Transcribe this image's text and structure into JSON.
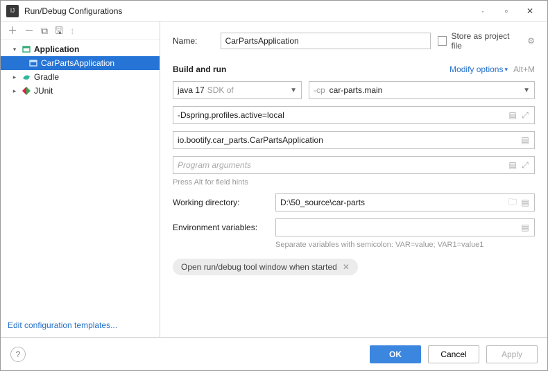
{
  "window": {
    "title": "Run/Debug Configurations"
  },
  "tree": {
    "root": "Application",
    "selected": "CarPartsApplication",
    "gradle": "Gradle",
    "junit": "JUnit"
  },
  "left_footer_link": "Edit configuration templates...",
  "form": {
    "name_label": "Name:",
    "name_value": "CarPartsApplication",
    "store_label": "Store as project file",
    "section": "Build and run",
    "modify": "Modify options",
    "modify_shortcut": "Alt+M",
    "jdk_text": "java 17",
    "jdk_suffix": "SDK of",
    "cp_prefix": "-cp",
    "cp_value": "car-parts.main",
    "vm_options": "-Dspring.profiles.active=local",
    "main_class": "io.bootify.car_parts.CarPartsApplication",
    "program_args_placeholder": "Program arguments",
    "hint": "Press Alt for field hints",
    "wd_label": "Working directory:",
    "wd_value": "D:\\50_source\\car-parts",
    "env_label": "Environment variables:",
    "env_hint": "Separate variables with semicolon: VAR=value; VAR1=value1",
    "pill": "Open run/debug tool window when started"
  },
  "buttons": {
    "ok": "OK",
    "cancel": "Cancel",
    "apply": "Apply"
  }
}
